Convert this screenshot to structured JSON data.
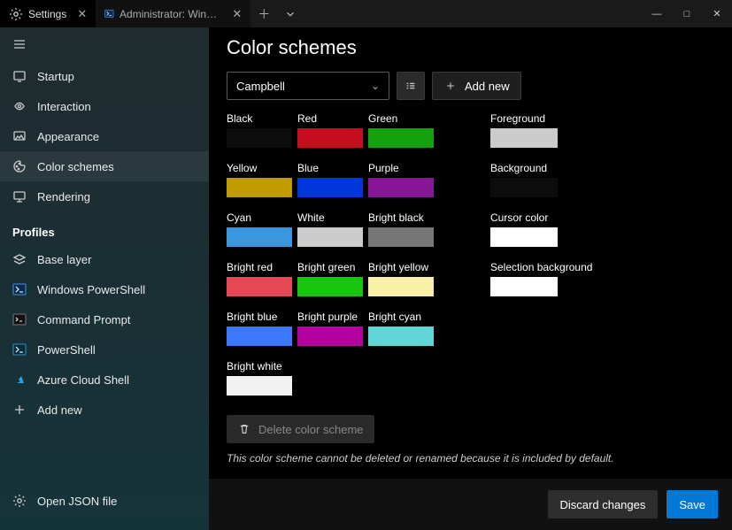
{
  "tabs": [
    {
      "title": "Settings",
      "icon": "gear"
    },
    {
      "title": "Administrator: Windows PowerS",
      "icon": "ps"
    }
  ],
  "window_buttons": {
    "min": "—",
    "max": "□",
    "close": "✕"
  },
  "sidebar": {
    "items": [
      {
        "label": "Startup",
        "icon": "startup"
      },
      {
        "label": "Interaction",
        "icon": "interaction"
      },
      {
        "label": "Appearance",
        "icon": "appearance"
      },
      {
        "label": "Color schemes",
        "icon": "color-schemes",
        "selected": true
      },
      {
        "label": "Rendering",
        "icon": "rendering"
      }
    ],
    "profiles_header": "Profiles",
    "profiles": [
      {
        "label": "Base layer",
        "icon": "layers"
      },
      {
        "label": "Windows PowerShell",
        "icon": "ps"
      },
      {
        "label": "Command Prompt",
        "icon": "cmd"
      },
      {
        "label": "PowerShell",
        "icon": "ps"
      },
      {
        "label": "Azure Cloud Shell",
        "icon": "azure"
      }
    ],
    "add_new": "Add new",
    "open_json": "Open JSON file"
  },
  "page": {
    "title": "Color schemes",
    "scheme_select": "Campbell",
    "add_new": "Add new",
    "delete_label": "Delete color scheme",
    "note": "This color scheme cannot be deleted or renamed because it is included by default."
  },
  "footer": {
    "discard": "Discard changes",
    "save": "Save"
  },
  "colors": {
    "row1": [
      {
        "name": "Black",
        "hex": "#0c0c0c"
      },
      {
        "name": "Red",
        "hex": "#c50f1f"
      },
      {
        "name": "Green",
        "hex": "#13a10e"
      },
      null,
      {
        "name": "Foreground",
        "hex": "#cccccc"
      }
    ],
    "row2": [
      {
        "name": "Yellow",
        "hex": "#c19c00"
      },
      {
        "name": "Blue",
        "hex": "#0037da"
      },
      {
        "name": "Purple",
        "hex": "#881798"
      },
      null,
      {
        "name": "Background",
        "hex": "#0c0c0c"
      }
    ],
    "row3": [
      {
        "name": "Cyan",
        "hex": "#3a96dd"
      },
      {
        "name": "White",
        "hex": "#cccccc"
      },
      {
        "name": "Bright black",
        "hex": "#767676"
      },
      null,
      {
        "name": "Cursor color",
        "hex": "#ffffff"
      }
    ],
    "row4": [
      {
        "name": "Bright red",
        "hex": "#e74856"
      },
      {
        "name": "Bright green",
        "hex": "#16c60c"
      },
      {
        "name": "Bright yellow",
        "hex": "#f9f1a5"
      },
      null,
      {
        "name": "Selection background",
        "hex": "#ffffff"
      }
    ],
    "row5": [
      {
        "name": "Bright blue",
        "hex": "#3b78ff"
      },
      {
        "name": "Bright purple",
        "hex": "#b4009e"
      },
      {
        "name": "Bright cyan",
        "hex": "#61d6d6"
      },
      null,
      null
    ],
    "row6": [
      {
        "name": "Bright white",
        "hex": "#f2f2f2"
      },
      null,
      null,
      null,
      null
    ]
  }
}
